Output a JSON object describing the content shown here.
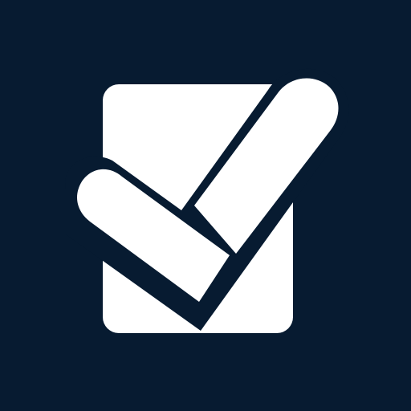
{
  "icon": {
    "name": "checkbox-checked-icon",
    "background_color": "#071b31",
    "foreground_color": "#ffffff"
  }
}
